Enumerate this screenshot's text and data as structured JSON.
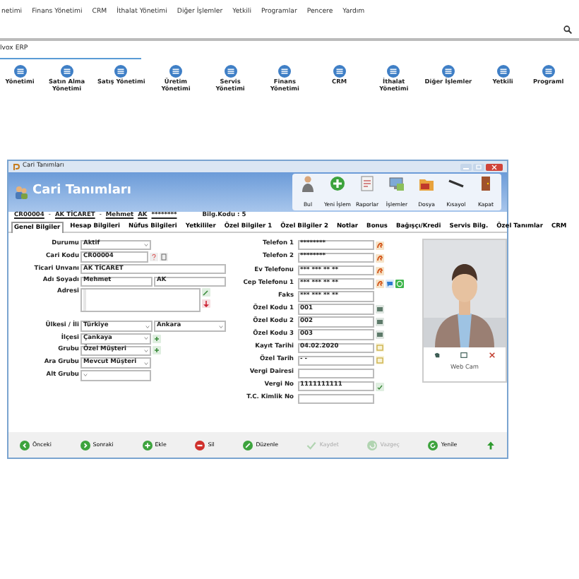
{
  "menu": [
    "netimi",
    "Finans Yönetimi",
    "CRM",
    "İthalat Yönetimi",
    "Diğer İşlemler",
    "Yetkili",
    "Programlar",
    "Pencere",
    "Yardım"
  ],
  "home_tab": {
    "label": "lvox ERP"
  },
  "modules": [
    "Yönetimi",
    "Satın Alma Yönetimi",
    "Satış Yönetimi",
    "Üretim Yönetimi",
    "Servis Yönetimi",
    "Finans Yönetimi",
    "CRM",
    "İthalat Yönetimi",
    "Diğer İşlemler",
    "Yetkili",
    "Programl"
  ],
  "window": {
    "title": "Cari Tanımları",
    "header": "Cari Tanımları",
    "toolbar": [
      {
        "label": "Bul",
        "kind": "find"
      },
      {
        "label": "Yeni İşlem",
        "kind": "new"
      },
      {
        "label": "Raporlar",
        "kind": "report"
      },
      {
        "label": "İşlemler",
        "kind": "process"
      },
      {
        "label": "Dosya",
        "kind": "folder"
      },
      {
        "label": "Kısayol",
        "kind": "shortcut"
      },
      {
        "label": "Kapat",
        "kind": "close"
      }
    ],
    "info": [
      "CR00004",
      "-",
      "AK TİCARET",
      "-",
      "Mehmet",
      "AK",
      "********"
    ],
    "info_code": "Bilg.Kodu : 5",
    "tabs": [
      {
        "label": "Genel Bilgiler",
        "selected": true
      },
      {
        "label": "Hesap Bilgileri",
        "selected": false
      },
      {
        "label": "Nüfus Bilgileri",
        "selected": false
      },
      {
        "label": "Yetkililer",
        "selected": false
      },
      {
        "label": "Özel Bilgiler 1",
        "selected": false
      },
      {
        "label": "Özel Bilgiler 2",
        "selected": false
      },
      {
        "label": "Notlar",
        "selected": false
      },
      {
        "label": "Bonus",
        "selected": false
      },
      {
        "label": "Bağışçı/Kredi",
        "selected": false
      },
      {
        "label": "Servis Bilg.",
        "selected": false
      },
      {
        "label": "Özel Tanımlar",
        "selected": false
      },
      {
        "label": "CRM",
        "selected": false
      }
    ],
    "left_fields": [
      {
        "label": "Durumu",
        "kind": "select",
        "value": "Aktif"
      },
      {
        "label": "Cari Kodu",
        "kind": "code",
        "value": "CR00004"
      },
      {
        "label": "Ticari Unvanı",
        "kind": "text",
        "value": "AK TİCARET"
      },
      {
        "label": "Adı Soyadı",
        "kind": "pair",
        "value": "Mehmet",
        "value_2": "AK"
      },
      {
        "label": "Adresi",
        "kind": "address"
      },
      {
        "label": "Ülkesi / İli",
        "kind": "select_pair",
        "value": "Türkiye",
        "value_2": "Ankara"
      },
      {
        "label": "İlçesi",
        "kind": "select_add",
        "value": "Çankaya"
      },
      {
        "label": "Grubu",
        "kind": "select_add",
        "value": "Özel Müşteri"
      },
      {
        "label": "Ara Grubu",
        "kind": "select",
        "value": "Mevcut Müşteri"
      },
      {
        "label": "Alt Grubu",
        "kind": "select"
      }
    ],
    "right_fields": [
      {
        "label": "Telefon 1",
        "value": "********",
        "kind": "phone"
      },
      {
        "label": "Telefon 2",
        "value": "********",
        "kind": "phone"
      },
      {
        "label": "Ev Telefonu",
        "value": "*** *** ** **",
        "kind": "phone"
      },
      {
        "label": "Cep Telefonu 1",
        "value": "*** *** ** **",
        "kind": "mobile"
      },
      {
        "label": "Faks",
        "value": "*** *** ** **",
        "kind": "plain"
      },
      {
        "label": "Özel Kodu 1",
        "value": "001",
        "kind": "code"
      },
      {
        "label": "Özel Kodu 2",
        "value": "002",
        "kind": "code"
      },
      {
        "label": "Özel Kodu 3",
        "value": "003",
        "kind": "code"
      },
      {
        "label": "Kayıt Tarihi",
        "value": "04.02.2020",
        "kind": "date"
      },
      {
        "label": "Özel Tarih",
        "value": "- -",
        "kind": "date"
      },
      {
        "label": "Vergi Dairesi",
        "kind": "plain"
      },
      {
        "label": "Vergi No",
        "value": "1111111111",
        "kind": "tax"
      },
      {
        "label": "T.C. Kimlik No",
        "kind": "plain"
      }
    ],
    "photo": {
      "kind": "picture",
      "caption": "Web Cam"
    },
    "actions": [
      {
        "label": "Önceki",
        "kind": "prev",
        "disabled": false
      },
      {
        "label": "Sonraki",
        "kind": "next",
        "disabled": false
      },
      {
        "label": "Ekle",
        "kind": "add",
        "disabled": false
      },
      {
        "label": "Sil",
        "kind": "delete",
        "disabled": false
      },
      {
        "label": "Düzenle",
        "kind": "edit",
        "disabled": false
      },
      {
        "label": "Kaydet",
        "kind": "save",
        "disabled": true
      },
      {
        "label": "Vazgeç",
        "kind": "cancel",
        "disabled": true
      },
      {
        "label": "Yenile",
        "kind": "refresh",
        "disabled": false
      },
      {
        "kind": "up",
        "disabled": false
      }
    ]
  }
}
